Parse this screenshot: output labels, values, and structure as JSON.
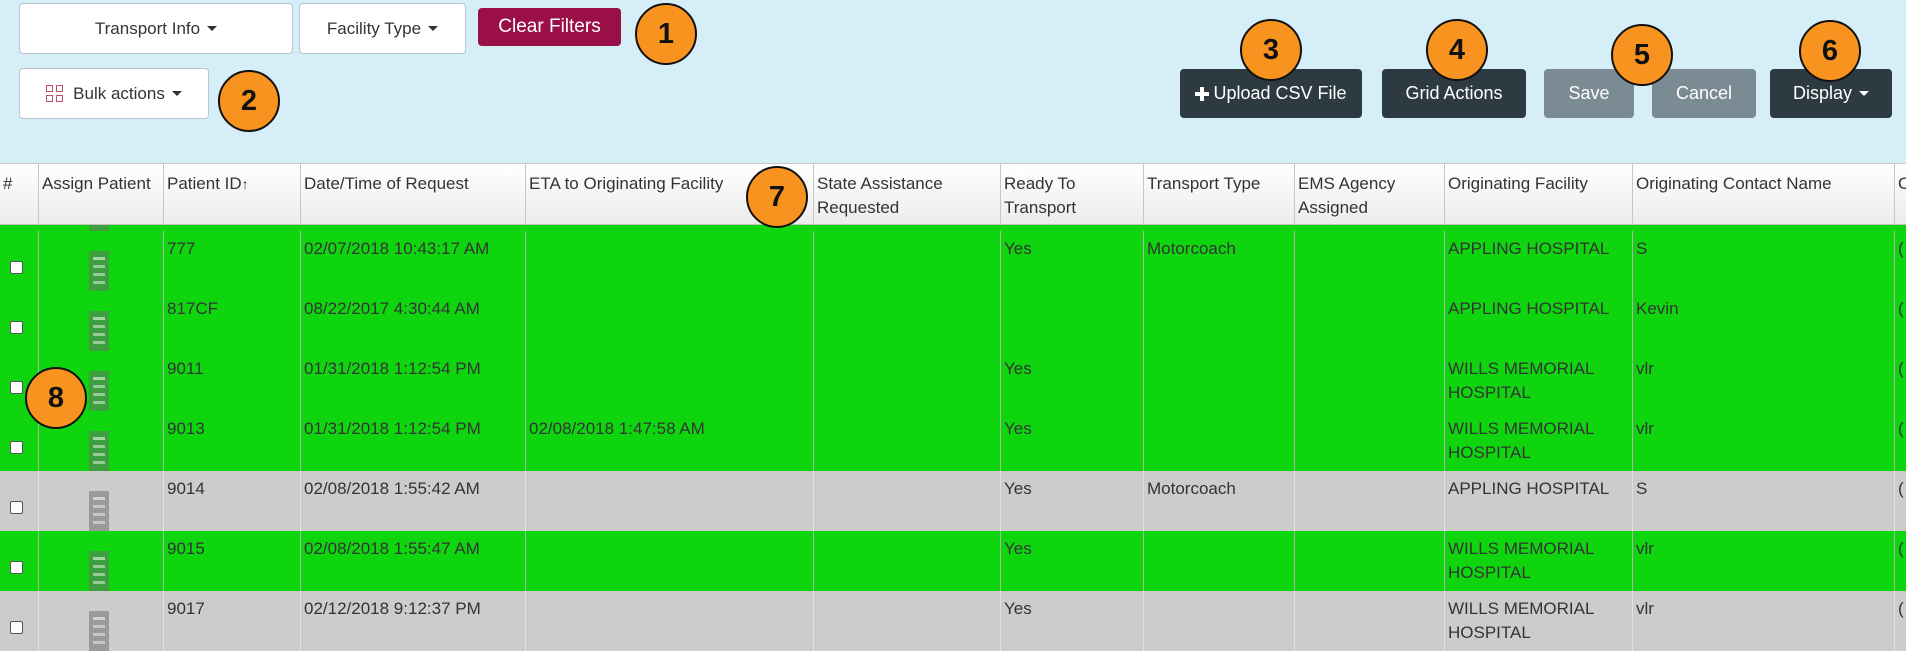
{
  "filters": {
    "transport_info": "Transport Info",
    "facility_type": "Facility Type",
    "clear_filters": "Clear Filters",
    "bulk_actions": "Bulk actions"
  },
  "actions": {
    "upload_csv": "Upload CSV File",
    "grid_actions": "Grid Actions",
    "save": "Save",
    "cancel": "Cancel",
    "display": "Display"
  },
  "markers": [
    "1",
    "2",
    "3",
    "4",
    "5",
    "6",
    "7",
    "8"
  ],
  "columns": {
    "num": "#",
    "assign": "Assign Patient",
    "patient_id": "Patient ID",
    "sort_indicator": "↑",
    "datetime": "Date/Time of Request",
    "eta": "ETA to Originating Facility",
    "state_assist": "State Assistance Requested",
    "ready": "Ready To Transport",
    "transport_type": "Transport Type",
    "ems": "EMS Agency Assigned",
    "orig_facility": "Originating Facility",
    "orig_contact": "Originating Contact Name",
    "next_partial": "O"
  },
  "rows": [
    {
      "id": "777",
      "datetime": "02/07/2018 10:43:17 AM",
      "eta": "",
      "state": "",
      "ready": "Yes",
      "transport": "Motorcoach",
      "ems": "",
      "facility": "APPLING HOSPITAL",
      "contact": "S",
      "status": "green"
    },
    {
      "id": "817CF",
      "datetime": "08/22/2017 4:30:44 AM",
      "eta": "",
      "state": "",
      "ready": "",
      "transport": "",
      "ems": "",
      "facility": "APPLING HOSPITAL",
      "contact": "Kevin",
      "status": "green"
    },
    {
      "id": "9011",
      "datetime": "01/31/2018 1:12:54 PM",
      "eta": "",
      "state": "",
      "ready": "Yes",
      "transport": "",
      "ems": "",
      "facility": "WILLS MEMORIAL HOSPITAL",
      "contact": "vlr",
      "status": "green"
    },
    {
      "id": "9013",
      "datetime": "01/31/2018 1:12:54 PM",
      "eta": "02/08/2018 1:47:58 AM",
      "state": "",
      "ready": "Yes",
      "transport": "",
      "ems": "",
      "facility": "WILLS MEMORIAL HOSPITAL",
      "contact": "vlr",
      "status": "green"
    },
    {
      "id": "9014",
      "datetime": "02/08/2018 1:55:42 AM",
      "eta": "",
      "state": "",
      "ready": "Yes",
      "transport": "Motorcoach",
      "ems": "",
      "facility": "APPLING HOSPITAL",
      "contact": "S",
      "status": "grey"
    },
    {
      "id": "9015",
      "datetime": "02/08/2018 1:55:47 AM",
      "eta": "",
      "state": "",
      "ready": "Yes",
      "transport": "",
      "ems": "",
      "facility": "WILLS MEMORIAL HOSPITAL",
      "contact": "vlr",
      "status": "green"
    },
    {
      "id": "9017",
      "datetime": "02/12/2018 9:12:37 PM",
      "eta": "",
      "state": "",
      "ready": "Yes",
      "transport": "",
      "ems": "",
      "facility": "WILLS MEMORIAL HOSPITAL",
      "contact": "vlr",
      "status": "grey"
    }
  ],
  "colors": {
    "toolbar_bg": "#d6eef8",
    "clear_filters": "#9b0f48",
    "dark_button": "#2e3a42",
    "grey_button": "#7b8b93",
    "marker": "#f7931e",
    "row_green": "#0fd50f",
    "row_grey": "#cccccc"
  }
}
